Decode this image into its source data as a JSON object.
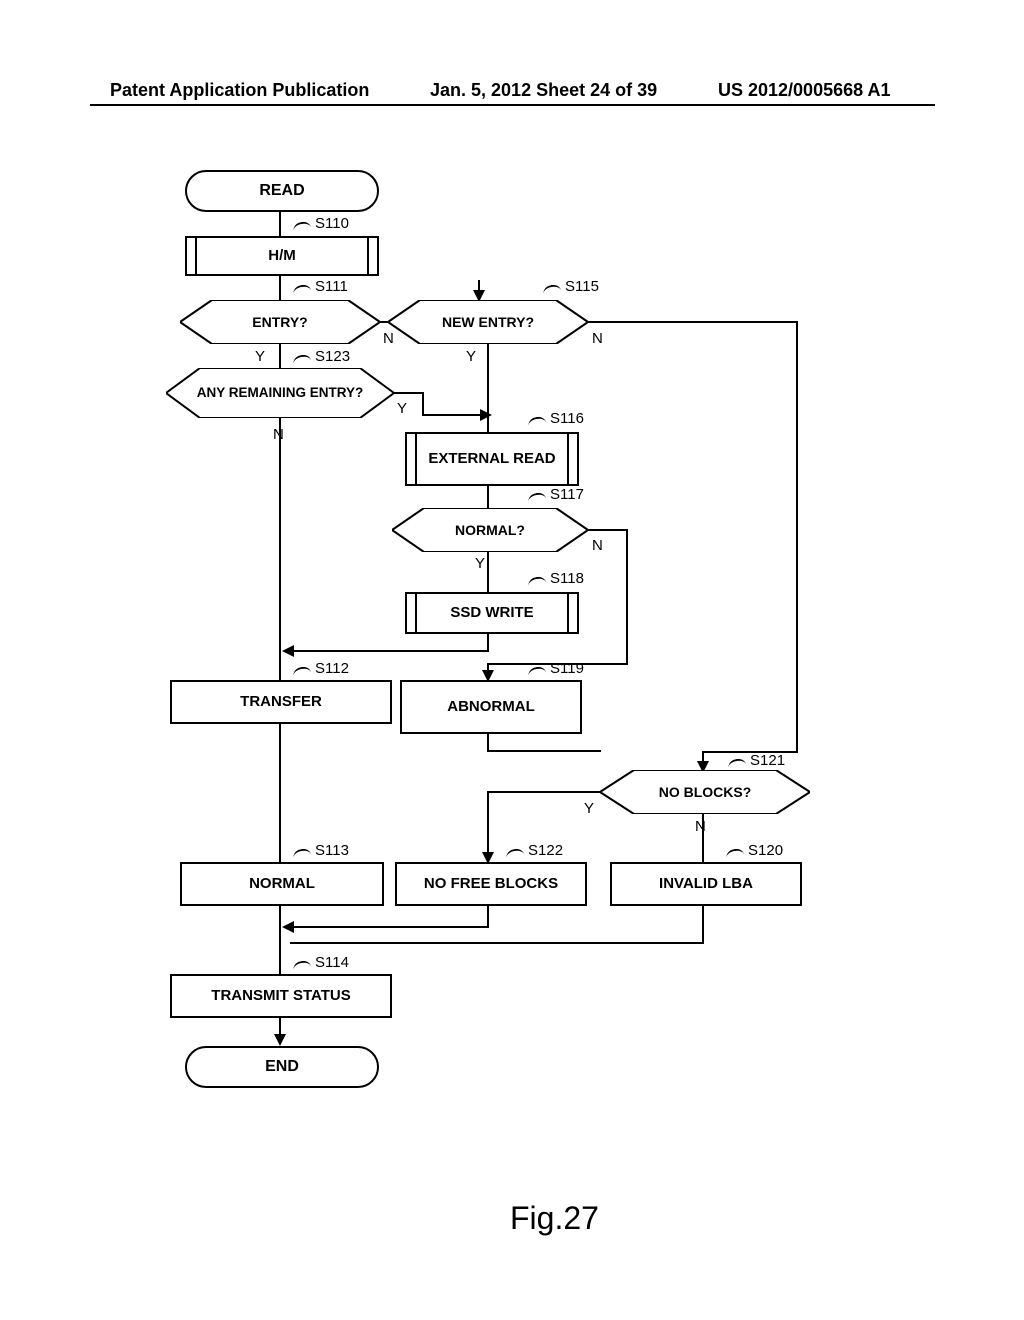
{
  "header": {
    "left": "Patent Application Publication",
    "center": "Jan. 5, 2012  Sheet 24 of 39",
    "right": "US 2012/0005668 A1"
  },
  "figure_label": "Fig.27",
  "nodes": {
    "start": "READ",
    "s110": {
      "id": "S110",
      "label": "H/M"
    },
    "s111": {
      "id": "S111",
      "label": "ENTRY?"
    },
    "s115": {
      "id": "S115",
      "label": "NEW ENTRY?"
    },
    "s123": {
      "id": "S123",
      "label": "ANY REMAINING ENTRY?"
    },
    "s116": {
      "id": "S116",
      "label": "EXTERNAL READ"
    },
    "s117": {
      "id": "S117",
      "label": "NORMAL?"
    },
    "s118": {
      "id": "S118",
      "label": "SSD WRITE"
    },
    "s112": {
      "id": "S112",
      "label": "TRANSFER"
    },
    "s119": {
      "id": "S119",
      "label": "ABNORMAL"
    },
    "s121": {
      "id": "S121",
      "label": "NO BLOCKS?"
    },
    "s113": {
      "id": "S113",
      "label": "NORMAL"
    },
    "s122": {
      "id": "S122",
      "label": "NO FREE BLOCKS"
    },
    "s120": {
      "id": "S120",
      "label": "INVALID LBA"
    },
    "s114": {
      "id": "S114",
      "label": "TRANSMIT STATUS"
    },
    "end": "END"
  },
  "branches": {
    "yes": "Y",
    "no": "N"
  },
  "chart_data": {
    "type": "flowchart",
    "title": "READ",
    "figure": "Fig.27",
    "nodes": [
      {
        "id": "start",
        "shape": "terminator",
        "label": "READ"
      },
      {
        "id": "S110",
        "shape": "predefined-process",
        "label": "H/M"
      },
      {
        "id": "S111",
        "shape": "decision",
        "label": "ENTRY?"
      },
      {
        "id": "S123",
        "shape": "decision",
        "label": "ANY REMAINING ENTRY?"
      },
      {
        "id": "S115",
        "shape": "decision",
        "label": "NEW ENTRY?"
      },
      {
        "id": "S116",
        "shape": "predefined-process",
        "label": "EXTERNAL READ"
      },
      {
        "id": "S117",
        "shape": "decision",
        "label": "NORMAL?"
      },
      {
        "id": "S118",
        "shape": "predefined-process",
        "label": "SSD WRITE"
      },
      {
        "id": "S112",
        "shape": "process",
        "label": "TRANSFER"
      },
      {
        "id": "S119",
        "shape": "process",
        "label": "ABNORMAL"
      },
      {
        "id": "S121",
        "shape": "decision",
        "label": "NO BLOCKS?"
      },
      {
        "id": "S113",
        "shape": "process",
        "label": "NORMAL"
      },
      {
        "id": "S122",
        "shape": "process",
        "label": "NO FREE BLOCKS"
      },
      {
        "id": "S120",
        "shape": "process",
        "label": "INVALID LBA"
      },
      {
        "id": "S114",
        "shape": "process",
        "label": "TRANSMIT STATUS"
      },
      {
        "id": "end",
        "shape": "terminator",
        "label": "END"
      }
    ],
    "edges": [
      {
        "from": "start",
        "to": "S110"
      },
      {
        "from": "S110",
        "to": "S111"
      },
      {
        "from": "S111",
        "to": "S123",
        "label": "Y"
      },
      {
        "from": "S111",
        "to": "S115",
        "label": "N"
      },
      {
        "from": "S123",
        "to": "S112",
        "label": "N"
      },
      {
        "from": "S123",
        "to": "S116",
        "label": "Y"
      },
      {
        "from": "S115",
        "to": "S116",
        "label": "Y"
      },
      {
        "from": "S115",
        "to": "S121",
        "label": "N"
      },
      {
        "from": "S116",
        "to": "S117"
      },
      {
        "from": "S117",
        "to": "S118",
        "label": "Y"
      },
      {
        "from": "S117",
        "to": "S119",
        "label": "N"
      },
      {
        "from": "S118",
        "to": "S112"
      },
      {
        "from": "S112",
        "to": "S113"
      },
      {
        "from": "S119",
        "to": "S121"
      },
      {
        "from": "S121",
        "to": "S122",
        "label": "Y"
      },
      {
        "from": "S121",
        "to": "S120",
        "label": "N"
      },
      {
        "from": "S113",
        "to": "S114"
      },
      {
        "from": "S122",
        "to": "S114"
      },
      {
        "from": "S120",
        "to": "S114"
      },
      {
        "from": "S114",
        "to": "end"
      }
    ]
  }
}
